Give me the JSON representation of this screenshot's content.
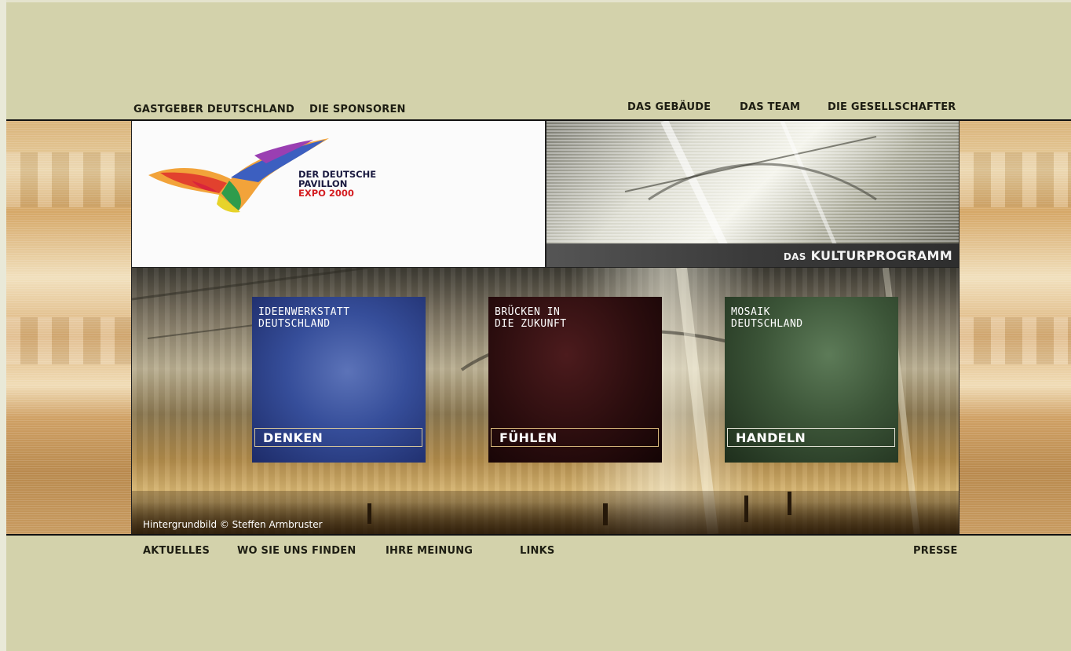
{
  "top_nav": {
    "left": [
      "GASTGEBER DEUTSCHLAND",
      "DIE SPONSOREN"
    ],
    "right": [
      "DAS GEBÄUDE",
      "DAS TEAM",
      "DIE GESELLSCHAFTER"
    ]
  },
  "logo": {
    "line1": "DER DEUTSCHE",
    "line2": "PAVILLON",
    "line3": "EXPO 2000"
  },
  "kultur": {
    "prefix": "DAS",
    "label": "KULTURPROGRAMM"
  },
  "tiles": [
    {
      "title": "IDEENWERKSTATT\nDEUTSCHLAND",
      "button": "DENKEN"
    },
    {
      "title": "BRÜCKEN IN\nDIE ZUKUNFT",
      "button": "FÜHLEN"
    },
    {
      "title": "MOSAIK\nDEUTSCHLAND",
      "button": "HANDELN"
    }
  ],
  "credit": "Hintergrundbild © Steffen Armbruster",
  "bottom_nav": [
    "AKTUELLES",
    "WO SIE UNS FINDEN",
    "IHRE MEINUNG",
    "LINKS",
    "PRESSE"
  ],
  "colors": {
    "background": "#d3d2ab",
    "logo_red": "#d41e22",
    "logo_navy": "#1a1a40"
  }
}
